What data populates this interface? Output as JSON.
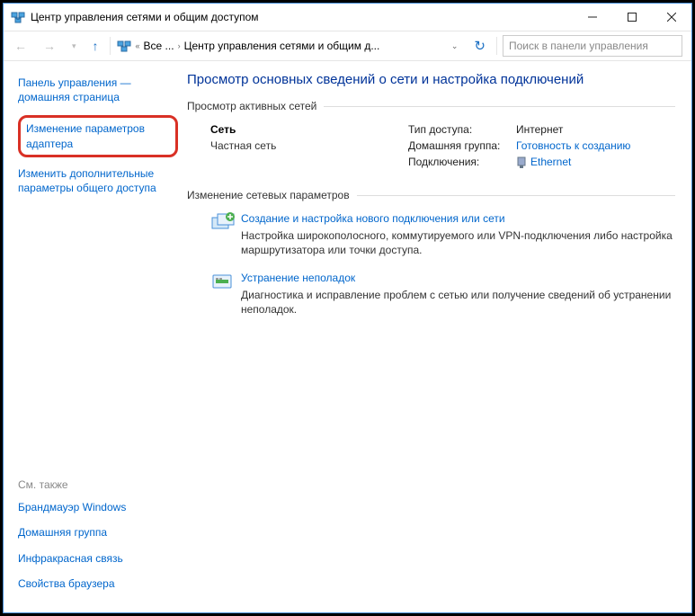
{
  "window": {
    "title": "Центр управления сетями и общим доступом"
  },
  "toolbar": {
    "crumb1": "Все ...",
    "crumb2": "Центр управления сетями и общим д...",
    "search_placeholder": "Поиск в панели управления"
  },
  "sidebar": {
    "home": "Панель управления — домашняя страница",
    "adapter": "Изменение параметров адаптера",
    "sharing": "Изменить дополнительные параметры общего доступа",
    "seealso_hd": "См. также",
    "seealso": {
      "firewall": "Брандмауэр Windows",
      "homegroup": "Домашняя группа",
      "infrared": "Инфракрасная связь",
      "inetopts": "Свойства браузера"
    }
  },
  "content": {
    "heading": "Просмотр основных сведений о сети и настройка подключений",
    "active_title": "Просмотр активных сетей",
    "network": {
      "name": "Сеть",
      "type": "Частная сеть",
      "access_k": "Тип доступа:",
      "access_v": "Интернет",
      "homegroup_k": "Домашняя группа:",
      "homegroup_v": "Готовность к созданию",
      "conn_k": "Подключения:",
      "conn_v": "Ethernet"
    },
    "change_title": "Изменение сетевых параметров",
    "task1": {
      "link": "Создание и настройка нового подключения или сети",
      "desc": "Настройка широкополосного, коммутируемого или VPN-подключения либо настройка маршрутизатора или точки доступа."
    },
    "task2": {
      "link": "Устранение неполадок",
      "desc": "Диагностика и исправление проблем с сетью или получение сведений об устранении неполадок."
    }
  }
}
